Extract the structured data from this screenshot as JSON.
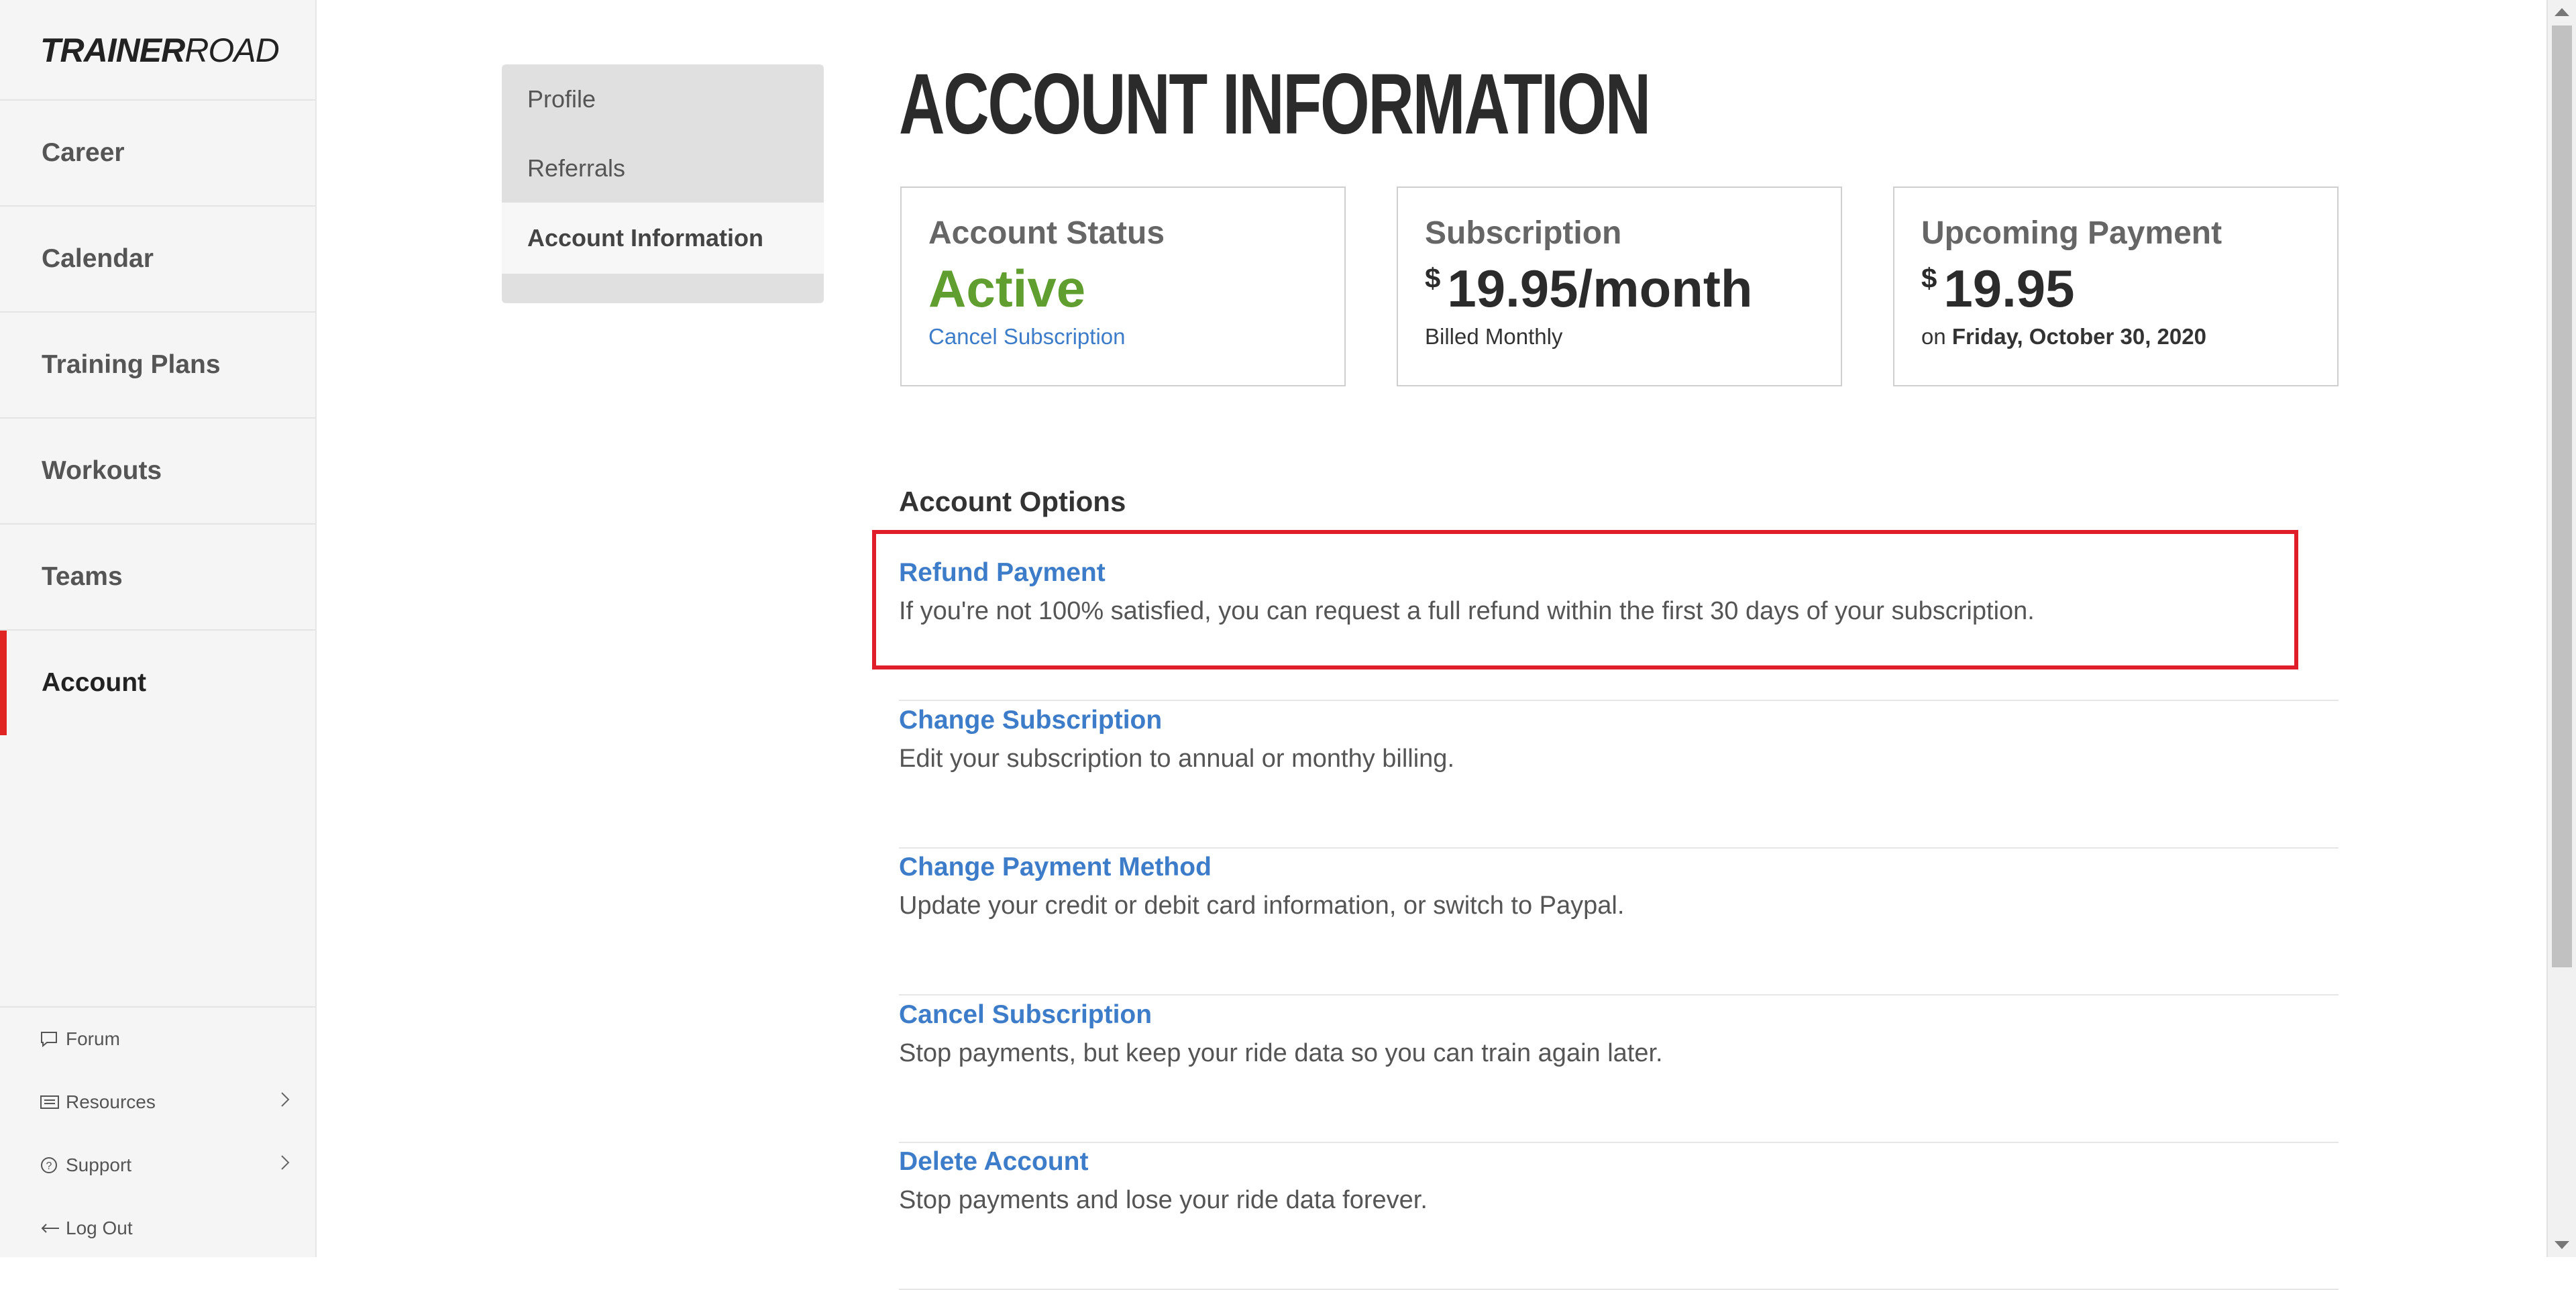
{
  "brand": {
    "logo_bold": "TRAINER",
    "logo_light": "ROAD"
  },
  "sidebar": {
    "items": [
      {
        "label": "Career"
      },
      {
        "label": "Calendar"
      },
      {
        "label": "Training Plans"
      },
      {
        "label": "Workouts"
      },
      {
        "label": "Teams"
      },
      {
        "label": "Account"
      }
    ],
    "active": "Account",
    "footer": [
      {
        "label": "Forum",
        "icon": "chat-bubble-icon"
      },
      {
        "label": "Resources",
        "icon": "newspaper-icon"
      },
      {
        "label": "Support",
        "icon": "question-circle-icon"
      },
      {
        "label": "Log Out",
        "icon": "arrow-left-icon"
      }
    ]
  },
  "subnav": {
    "items": [
      {
        "label": "Profile"
      },
      {
        "label": "Referrals"
      },
      {
        "label": "Account Information"
      }
    ],
    "active": "Account Information"
  },
  "page": {
    "title": "ACCOUNT INFORMATION"
  },
  "cards": {
    "status": {
      "label": "Account Status",
      "value": "Active",
      "link": "Cancel Subscription"
    },
    "subscription": {
      "label": "Subscription",
      "currency": "$",
      "value": "19.95/month",
      "sub": "Billed Monthly"
    },
    "payment": {
      "label": "Upcoming Payment",
      "currency": "$",
      "value": "19.95",
      "sub_prefix": "on",
      "date": "Friday, October 30, 2020"
    }
  },
  "options": {
    "heading": "Account Options",
    "items": [
      {
        "title": "Refund Payment",
        "desc": "If you're not 100% satisfied, you can request a full refund within the first 30 days of your subscription."
      },
      {
        "title": "Change Subscription",
        "desc": "Edit your subscription to annual or monthy billing."
      },
      {
        "title": "Change Payment Method",
        "desc": "Update your credit or debit card information, or switch to Paypal."
      },
      {
        "title": "Cancel Subscription",
        "desc": "Stop payments, but keep your ride data so you can train again later."
      },
      {
        "title": "Delete Account",
        "desc": "Stop payments and lose your ride data forever."
      }
    ]
  },
  "colors": {
    "accent": "#e02424",
    "link": "#3d7cc9",
    "active_status": "#5f9e2f",
    "highlight": "#e01e2a"
  }
}
